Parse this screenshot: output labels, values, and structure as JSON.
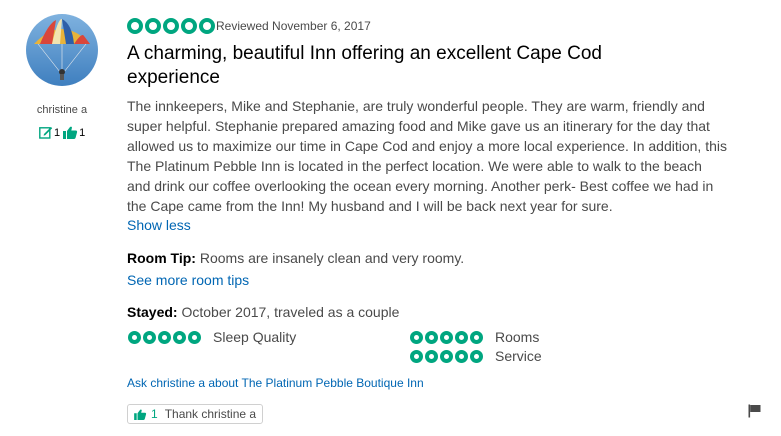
{
  "user": {
    "name": "christine a",
    "contributions": "1",
    "helpful_votes": "1"
  },
  "review": {
    "rating": 5,
    "date": "Reviewed November 6, 2017",
    "title": "A charming, beautiful Inn offering an excellent Cape Cod experience",
    "body": "The innkeepers, Mike and Stephanie, are truly wonderful people. They are warm, friendly and super helpful. Stephanie prepared amazing food and Mike gave us an itinerary for the day that allowed us to maximize our time in Cape Cod and enjoy a more local experience. In addition, this The Platinum Pebble Inn is located in the perfect location. We were able to walk to the beach and drink our coffee overlooking the ocean every morning. Another perk- Best coffee we had in the Cape came from the Inn! My husband and I will be back next year for sure.",
    "show_less": "Show less",
    "room_tip_label": "Room Tip:",
    "room_tip": "Rooms are insanely clean and very roomy.",
    "more_room_tips": "See more room tips",
    "stayed_label": "Stayed:",
    "stayed": "October 2017, traveled as a couple",
    "sub_ratings": [
      {
        "label": "Sleep Quality",
        "rating": 5
      },
      {
        "label": "Rooms",
        "rating": 5
      },
      {
        "label": "Service",
        "rating": 5
      }
    ],
    "ask_link": "Ask christine a about The Platinum Pebble Boutique Inn",
    "thank_count": "1",
    "thank_label": "Thank christine a"
  },
  "colors": {
    "bubble": "#00a680",
    "link": "#0066b3"
  },
  "icons": {
    "contributions": "review-pencil-icon",
    "helpful": "thumbs-up-icon",
    "report": "flag-icon"
  }
}
